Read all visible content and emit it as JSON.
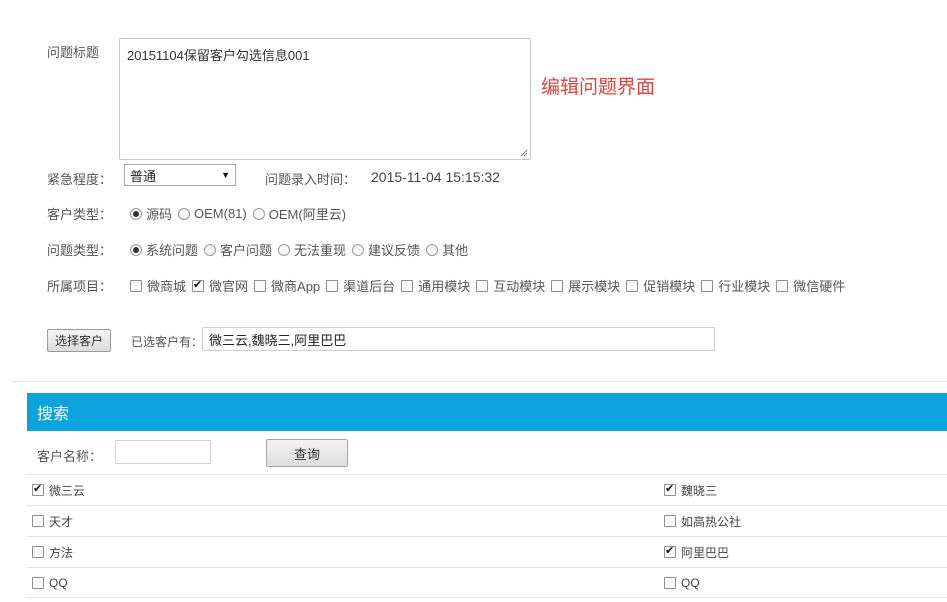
{
  "form": {
    "title_label": "问题标题",
    "title_value": "20151104保留客户勾选信息001",
    "edit_note": "编辑问题界面",
    "urgency_label": "紧急程度：",
    "urgency_value": "普通",
    "entry_time_label": "问题录入时间：",
    "entry_time_value": "2015-11-04 15:15:32",
    "customer_type_label": "客户类型：",
    "customer_types": [
      {
        "label": "源码",
        "checked": true
      },
      {
        "label": "OEM(81)",
        "checked": false
      },
      {
        "label": "OEM(阿里云)",
        "checked": false
      }
    ],
    "issue_type_label": "问题类型：",
    "issue_types": [
      {
        "label": "系统问题",
        "checked": true
      },
      {
        "label": "客户问题",
        "checked": false
      },
      {
        "label": "无法重现",
        "checked": false
      },
      {
        "label": "建议反馈",
        "checked": false
      },
      {
        "label": "其他",
        "checked": false
      }
    ],
    "project_label": "所属项目：",
    "projects": [
      {
        "label": "微商城",
        "checked": false
      },
      {
        "label": "微官网",
        "checked": true
      },
      {
        "label": "微商App",
        "checked": false
      },
      {
        "label": "渠道后台",
        "checked": false
      },
      {
        "label": "通用模块",
        "checked": false
      },
      {
        "label": "互动模块",
        "checked": false
      },
      {
        "label": "展示模块",
        "checked": false
      },
      {
        "label": "促销模块",
        "checked": false
      },
      {
        "label": "行业模块",
        "checked": false
      },
      {
        "label": "微信硬件",
        "checked": false
      }
    ],
    "choose_customer_button": "选择客户",
    "selected_customers_label": "已选客户有：",
    "selected_customers_value": "微三云,魏晓三,阿里巴巴"
  },
  "search": {
    "header": "搜索",
    "customer_name_label": "客户名称：",
    "customer_name_value": "",
    "query_button": "查询",
    "rows": [
      [
        {
          "label": "微三云",
          "checked": true
        },
        {
          "label": "魏晓三",
          "checked": true
        }
      ],
      [
        {
          "label": "天才",
          "checked": false
        },
        {
          "label": "如高热公社",
          "checked": false
        }
      ],
      [
        {
          "label": "方法",
          "checked": false
        },
        {
          "label": "阿里巴巴",
          "checked": true
        }
      ],
      [
        {
          "label": "QQ",
          "checked": false
        },
        {
          "label": "QQ",
          "checked": false
        }
      ]
    ]
  }
}
